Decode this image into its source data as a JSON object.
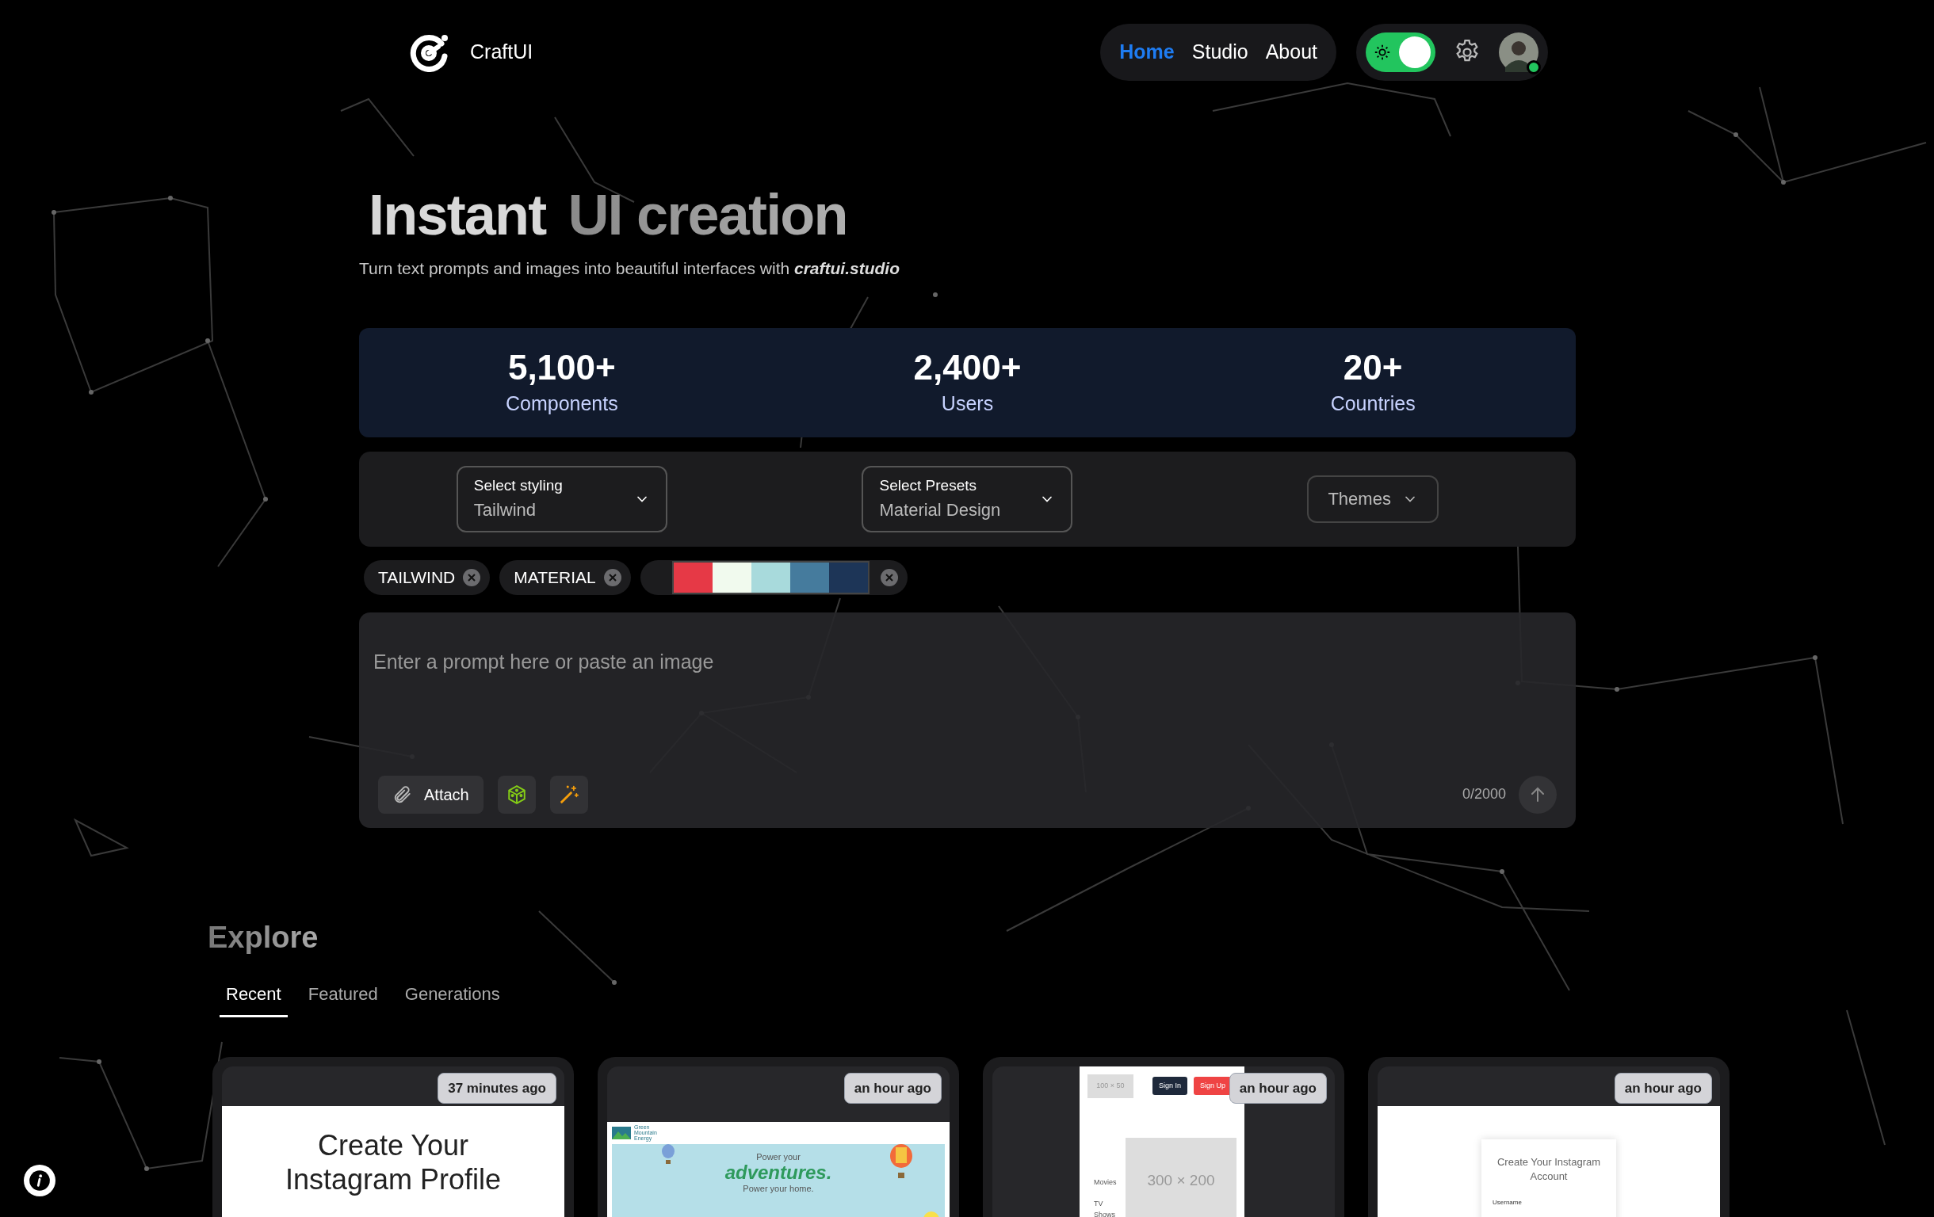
{
  "header": {
    "brand": "CraftUI",
    "nav": [
      {
        "label": "Home",
        "selected": true
      },
      {
        "label": "Studio",
        "selected": false
      },
      {
        "label": "About",
        "selected": false
      }
    ],
    "theme_toggle": {
      "on": true
    },
    "user": {
      "online": true
    }
  },
  "hero": {
    "title_lead": "Instant",
    "title_rest": "UI creation",
    "subtitle": "Turn text prompts and images into beautiful interfaces with",
    "subtitle_link": "craftui.studio"
  },
  "stats": [
    {
      "value": "5,100+",
      "label": "Components"
    },
    {
      "value": "2,400+",
      "label": "Users"
    },
    {
      "value": "20+",
      "label": "Countries"
    }
  ],
  "options": {
    "dropdowns": [
      {
        "label": "Select styling",
        "value": "Tailwind"
      },
      {
        "label": "Select Presets",
        "value": "Material Design"
      }
    ],
    "themes_button": "Themes"
  },
  "chips": [
    {
      "kind": "text",
      "label": "TAILWIND"
    },
    {
      "kind": "text",
      "label": "MATERIAL"
    },
    {
      "kind": "palette",
      "swatches": [
        {
          "color": "#e63946"
        },
        {
          "color": "#f1faee"
        },
        {
          "color": "#a8dadc"
        },
        {
          "color": "#457b9d"
        },
        {
          "color": "#1d3557"
        }
      ]
    }
  ],
  "prompt": {
    "placeholder": "Enter a prompt here or paste an image",
    "attach": "Attach",
    "counter": "0/2000"
  },
  "explore": {
    "title": "Explore",
    "tabs": [
      {
        "label": "Recent",
        "selected": true
      },
      {
        "label": "Featured",
        "selected": false
      },
      {
        "label": "Generations",
        "selected": false
      }
    ],
    "cards": [
      {
        "kind": "profile",
        "time": "37 minutes ago",
        "title": "Create Your Instagram Profile"
      },
      {
        "kind": "landing",
        "time": "an hour ago",
        "brand": "Green Mountain Energy",
        "kicker": "Power your",
        "headline": "adventures.",
        "tagline": "Power your home."
      },
      {
        "kind": "layout",
        "time": "an hour ago",
        "logo": "100 × 50",
        "sign_in": "Sign In",
        "sign_up": "Sign Up",
        "menu": [
          "Movies",
          "TV Shows"
        ],
        "image": "300 × 200"
      },
      {
        "kind": "signup",
        "time": "an hour ago",
        "title": "Create Your Instagram Account",
        "field": "Username"
      }
    ]
  }
}
